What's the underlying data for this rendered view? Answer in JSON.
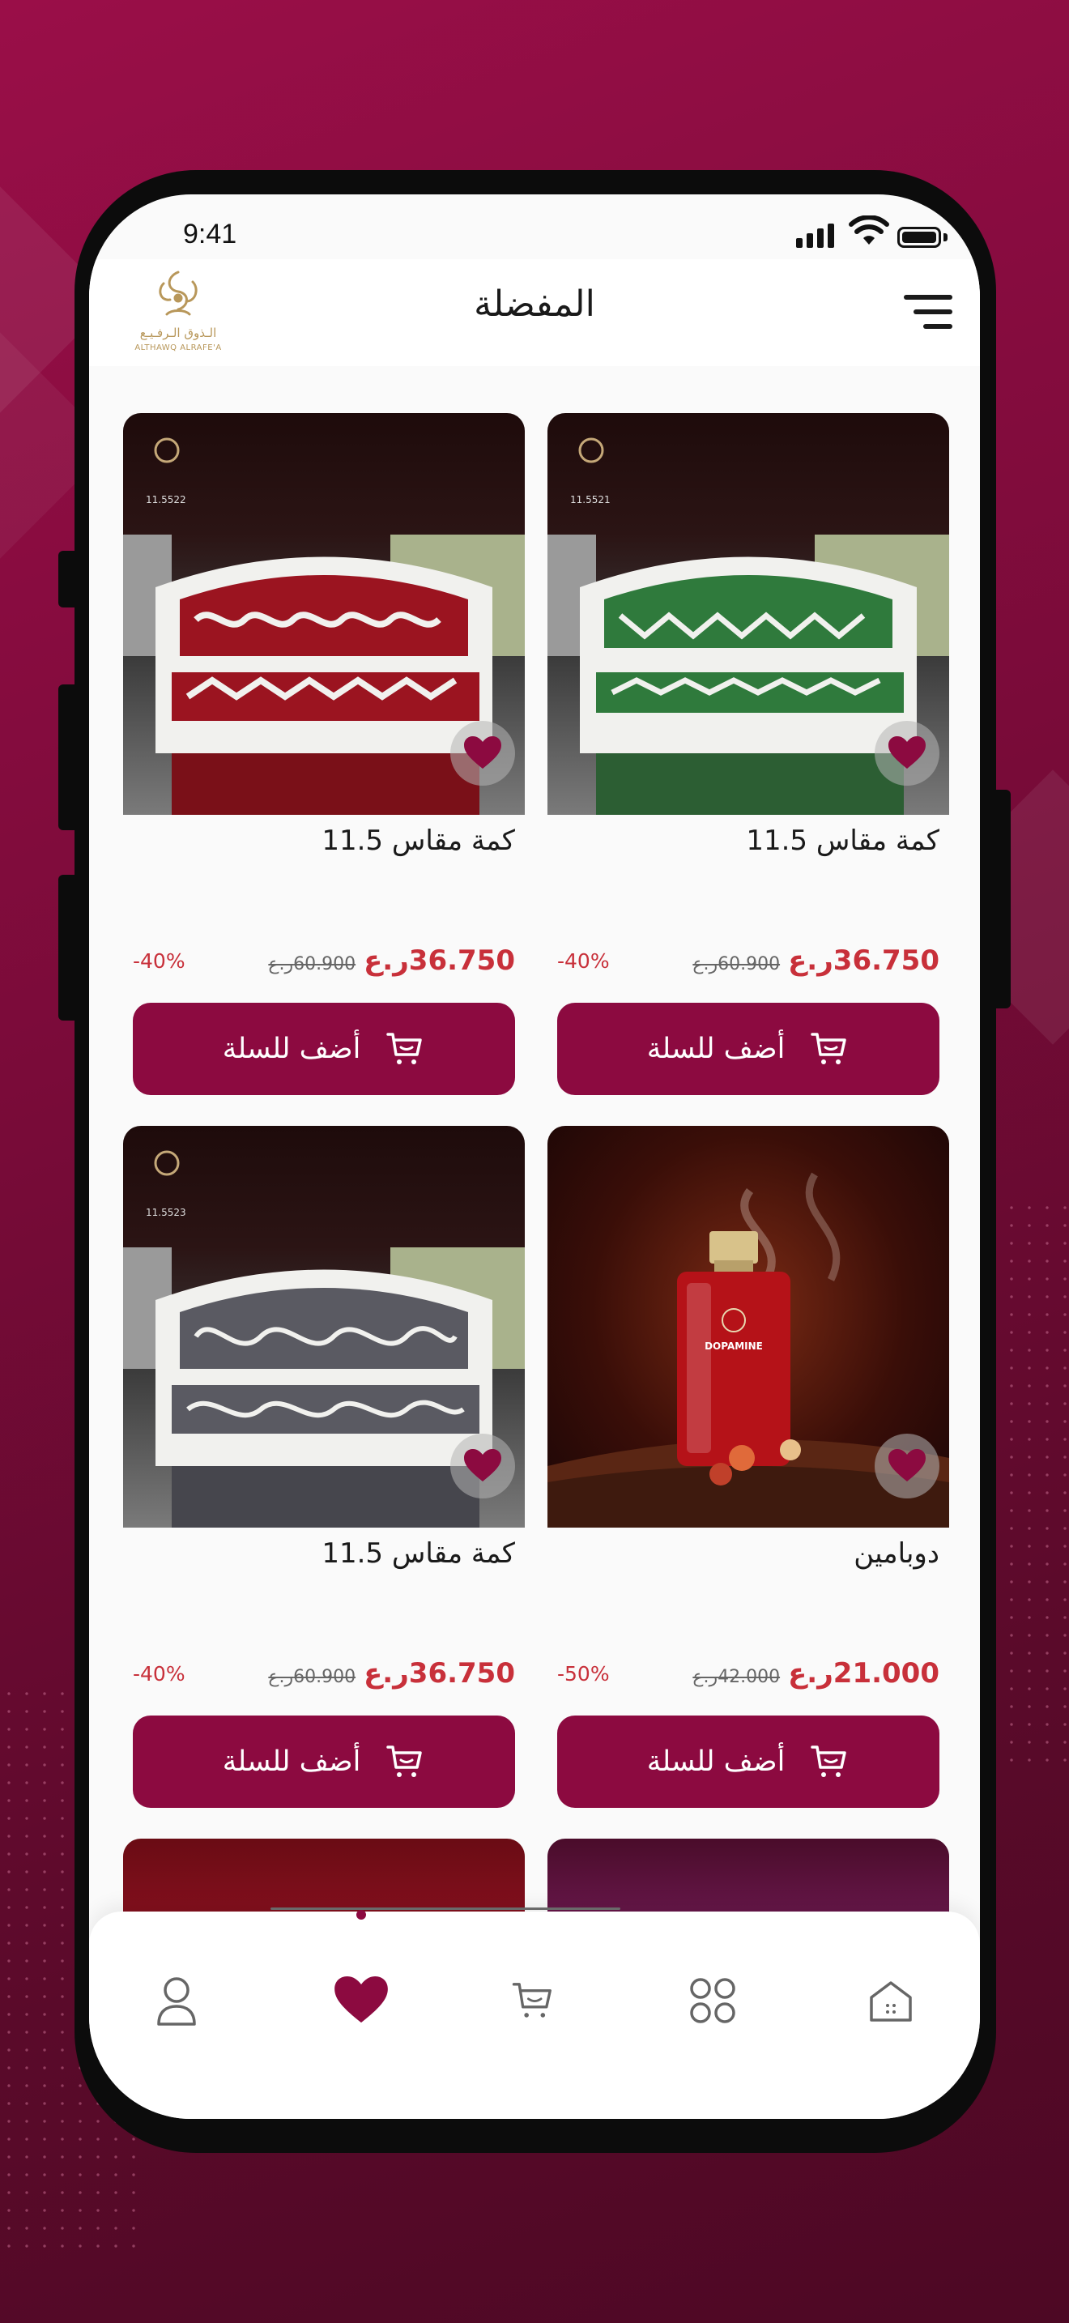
{
  "status": {
    "time": "9:41"
  },
  "header": {
    "title": "المفضلة",
    "logo_text_ar": "الـذوق الـرفـيـع",
    "logo_text_en": "ALTHAWQ ALRAFE'A"
  },
  "products": [
    {
      "name": "كمة مقاس 11.5",
      "price": "36.750ر.ع",
      "old_price": "60.900ر.ع",
      "discount": "-40%",
      "button": "أضف للسلة",
      "image": "green-kuma-cap",
      "image_code": "11.5521"
    },
    {
      "name": "كمة مقاس 11.5",
      "price": "36.750ر.ع",
      "old_price": "60.900ر.ع",
      "discount": "-40%",
      "button": "أضف للسلة",
      "image": "red-kuma-cap",
      "image_code": "11.5522"
    },
    {
      "name": "دوبامين",
      "price": "21.000ر.ع",
      "old_price": "42.000ر.ع",
      "discount": "-50%",
      "button": "أضف للسلة",
      "image": "red-perfume-bottle",
      "image_code": "DOPAMINE"
    },
    {
      "name": "كمة مقاس 11.5",
      "price": "36.750ر.ع",
      "old_price": "60.900ر.ع",
      "discount": "-40%",
      "button": "أضف للسلة",
      "image": "grey-kuma-cap",
      "image_code": "11.5523"
    }
  ],
  "nav": {
    "items": [
      "home-icon",
      "categories-icon",
      "cart-icon",
      "favorites-icon",
      "profile-icon"
    ],
    "active": "favorites-icon"
  },
  "colors": {
    "accent": "#8c0a40",
    "price": "#c8303a",
    "background": "#7a0b39"
  }
}
